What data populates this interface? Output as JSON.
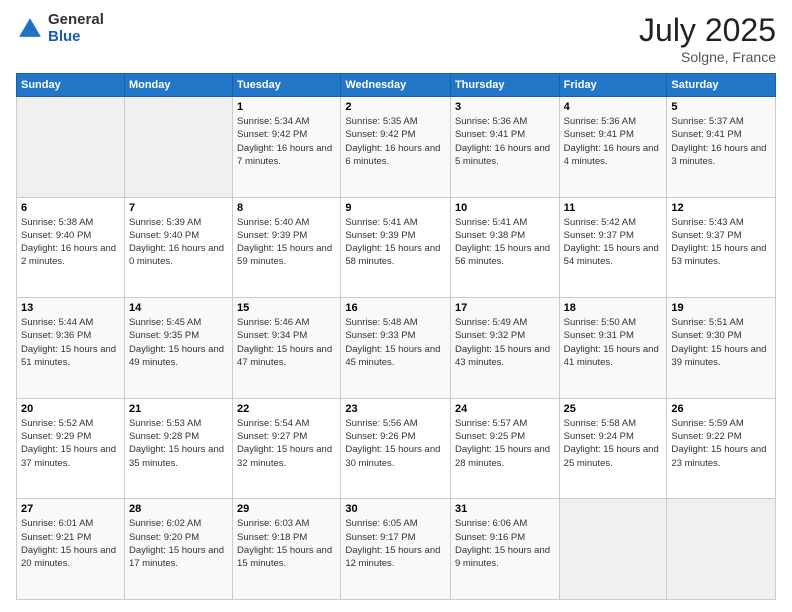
{
  "header": {
    "logo_general": "General",
    "logo_blue": "Blue",
    "title": "July 2025",
    "location": "Solgne, France"
  },
  "days_of_week": [
    "Sunday",
    "Monday",
    "Tuesday",
    "Wednesday",
    "Thursday",
    "Friday",
    "Saturday"
  ],
  "weeks": [
    [
      {
        "day": "",
        "info": ""
      },
      {
        "day": "",
        "info": ""
      },
      {
        "day": "1",
        "info": "Sunrise: 5:34 AM\nSunset: 9:42 PM\nDaylight: 16 hours and 7 minutes."
      },
      {
        "day": "2",
        "info": "Sunrise: 5:35 AM\nSunset: 9:42 PM\nDaylight: 16 hours and 6 minutes."
      },
      {
        "day": "3",
        "info": "Sunrise: 5:36 AM\nSunset: 9:41 PM\nDaylight: 16 hours and 5 minutes."
      },
      {
        "day": "4",
        "info": "Sunrise: 5:36 AM\nSunset: 9:41 PM\nDaylight: 16 hours and 4 minutes."
      },
      {
        "day": "5",
        "info": "Sunrise: 5:37 AM\nSunset: 9:41 PM\nDaylight: 16 hours and 3 minutes."
      }
    ],
    [
      {
        "day": "6",
        "info": "Sunrise: 5:38 AM\nSunset: 9:40 PM\nDaylight: 16 hours and 2 minutes."
      },
      {
        "day": "7",
        "info": "Sunrise: 5:39 AM\nSunset: 9:40 PM\nDaylight: 16 hours and 0 minutes."
      },
      {
        "day": "8",
        "info": "Sunrise: 5:40 AM\nSunset: 9:39 PM\nDaylight: 15 hours and 59 minutes."
      },
      {
        "day": "9",
        "info": "Sunrise: 5:41 AM\nSunset: 9:39 PM\nDaylight: 15 hours and 58 minutes."
      },
      {
        "day": "10",
        "info": "Sunrise: 5:41 AM\nSunset: 9:38 PM\nDaylight: 15 hours and 56 minutes."
      },
      {
        "day": "11",
        "info": "Sunrise: 5:42 AM\nSunset: 9:37 PM\nDaylight: 15 hours and 54 minutes."
      },
      {
        "day": "12",
        "info": "Sunrise: 5:43 AM\nSunset: 9:37 PM\nDaylight: 15 hours and 53 minutes."
      }
    ],
    [
      {
        "day": "13",
        "info": "Sunrise: 5:44 AM\nSunset: 9:36 PM\nDaylight: 15 hours and 51 minutes."
      },
      {
        "day": "14",
        "info": "Sunrise: 5:45 AM\nSunset: 9:35 PM\nDaylight: 15 hours and 49 minutes."
      },
      {
        "day": "15",
        "info": "Sunrise: 5:46 AM\nSunset: 9:34 PM\nDaylight: 15 hours and 47 minutes."
      },
      {
        "day": "16",
        "info": "Sunrise: 5:48 AM\nSunset: 9:33 PM\nDaylight: 15 hours and 45 minutes."
      },
      {
        "day": "17",
        "info": "Sunrise: 5:49 AM\nSunset: 9:32 PM\nDaylight: 15 hours and 43 minutes."
      },
      {
        "day": "18",
        "info": "Sunrise: 5:50 AM\nSunset: 9:31 PM\nDaylight: 15 hours and 41 minutes."
      },
      {
        "day": "19",
        "info": "Sunrise: 5:51 AM\nSunset: 9:30 PM\nDaylight: 15 hours and 39 minutes."
      }
    ],
    [
      {
        "day": "20",
        "info": "Sunrise: 5:52 AM\nSunset: 9:29 PM\nDaylight: 15 hours and 37 minutes."
      },
      {
        "day": "21",
        "info": "Sunrise: 5:53 AM\nSunset: 9:28 PM\nDaylight: 15 hours and 35 minutes."
      },
      {
        "day": "22",
        "info": "Sunrise: 5:54 AM\nSunset: 9:27 PM\nDaylight: 15 hours and 32 minutes."
      },
      {
        "day": "23",
        "info": "Sunrise: 5:56 AM\nSunset: 9:26 PM\nDaylight: 15 hours and 30 minutes."
      },
      {
        "day": "24",
        "info": "Sunrise: 5:57 AM\nSunset: 9:25 PM\nDaylight: 15 hours and 28 minutes."
      },
      {
        "day": "25",
        "info": "Sunrise: 5:58 AM\nSunset: 9:24 PM\nDaylight: 15 hours and 25 minutes."
      },
      {
        "day": "26",
        "info": "Sunrise: 5:59 AM\nSunset: 9:22 PM\nDaylight: 15 hours and 23 minutes."
      }
    ],
    [
      {
        "day": "27",
        "info": "Sunrise: 6:01 AM\nSunset: 9:21 PM\nDaylight: 15 hours and 20 minutes."
      },
      {
        "day": "28",
        "info": "Sunrise: 6:02 AM\nSunset: 9:20 PM\nDaylight: 15 hours and 17 minutes."
      },
      {
        "day": "29",
        "info": "Sunrise: 6:03 AM\nSunset: 9:18 PM\nDaylight: 15 hours and 15 minutes."
      },
      {
        "day": "30",
        "info": "Sunrise: 6:05 AM\nSunset: 9:17 PM\nDaylight: 15 hours and 12 minutes."
      },
      {
        "day": "31",
        "info": "Sunrise: 6:06 AM\nSunset: 9:16 PM\nDaylight: 15 hours and 9 minutes."
      },
      {
        "day": "",
        "info": ""
      },
      {
        "day": "",
        "info": ""
      }
    ]
  ]
}
